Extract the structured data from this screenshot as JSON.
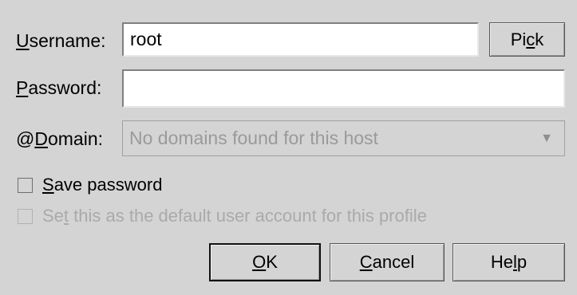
{
  "form": {
    "username": {
      "label_prefix": "",
      "label_access": "U",
      "label_rest": "sername:",
      "value": "root"
    },
    "password": {
      "label_prefix": "",
      "label_access": "P",
      "label_rest": "assword:",
      "value": ""
    },
    "domain": {
      "label_prefix": "@",
      "label_access": "D",
      "label_rest": "omain:",
      "value": "No domains found for this host"
    }
  },
  "buttons": {
    "pick": {
      "prefix": "Pi",
      "access": "c",
      "rest": "k"
    },
    "ok": {
      "prefix": "",
      "access": "O",
      "rest": "K"
    },
    "cancel": {
      "prefix": "",
      "access": "C",
      "rest": "ancel"
    },
    "help": {
      "prefix": "He",
      "access": "l",
      "rest": "p"
    }
  },
  "checkboxes": {
    "save_password": {
      "prefix": "",
      "access": "S",
      "rest": "ave password",
      "checked": false
    },
    "default_account": {
      "prefix": "Se",
      "access": "t",
      "rest": " this as the default user account for this profile",
      "checked": false,
      "enabled": false
    }
  },
  "icons": {
    "domain_dropdown": "chevron-down-icon"
  },
  "colors": {
    "background": "#d4d4d4",
    "disabled_text": "#9a9a9a",
    "field_background": "#ffffff"
  }
}
